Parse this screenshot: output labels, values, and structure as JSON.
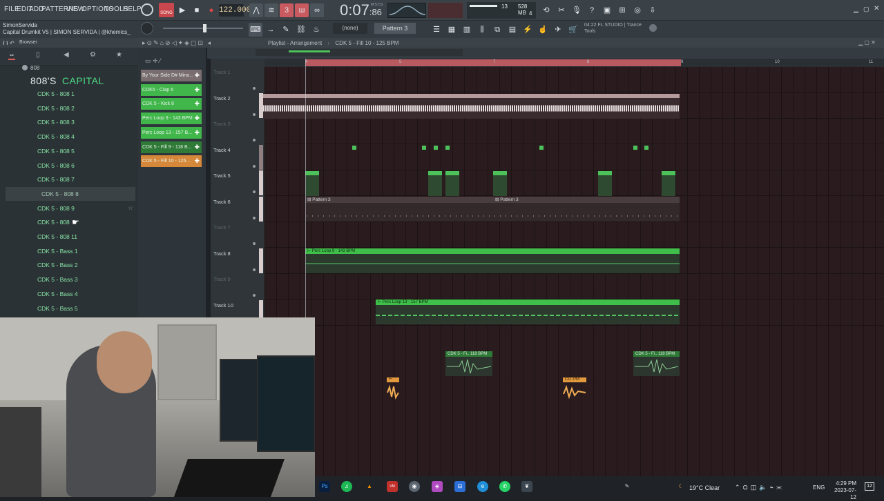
{
  "menu": {
    "items": [
      "FILE",
      "EDIT",
      "ADD",
      "PATTERNS",
      "VIEW",
      "OPTIONS",
      "TOOLS",
      "HELP"
    ]
  },
  "transport": {
    "mode_label": "SONG",
    "tempo": "122.000",
    "song_time_main": "0:07",
    "song_time_sub": "86",
    "time_label": "M:S:CS",
    "memory": "528 MB",
    "voices": "13",
    "cpu_cores": "4"
  },
  "project": {
    "author": "SimonServida",
    "title": "Capital Drumkit V5 | SIMON SERVIDA | @khemics_"
  },
  "toolbar2": {
    "none_selector": "(none)",
    "pattern_selector": "Pattern 3",
    "hint_line1": "04:22  FL STUDIO | Trance",
    "hint_line2": "Tools"
  },
  "browser": {
    "title": "Browser",
    "folder_label": "808",
    "brand_left": "808'S",
    "brand_right": "CAPITAL",
    "items": [
      "CDK 5 - 808 1",
      "CDK 5 - 808 2",
      "CDK 5 - 808 3",
      "CDK 5 - 808 4",
      "CDK 5 - 808 5",
      "CDK 5 - 808 6",
      "CDK 5 - 808 7",
      "CDK 5 - 808 8",
      "CDK 5 - 808 9",
      "CDK 5 - 808 10",
      "CDK 5 - 808 11",
      "CDK 5 - Bass 1",
      "CDK 5 - Bass 2",
      "CDK 5 - Bass 3",
      "CDK 5 - Bass 4",
      "CDK 5 - Bass 5"
    ],
    "items_display": [
      "CDK 5 - 808 1",
      "CDK 5 - 808 2",
      "CDK 5 - 808 3",
      "CDK 5 - 808 4",
      "CDK 5 - 808 5",
      "CDK 5 - 808 6",
      "CDK 5 - 808 7",
      "CDK 5 - 808 8",
      "CDK 5 - 808 9",
      "CDK 5 - 808",
      "CDK 5 - 808 11",
      "CDK 5 - Bass 1",
      "CDK 5 - Bass 2",
      "CDK 5 - Bass 3",
      "CDK 5 - Bass 4",
      "CDK 5 - Bass 5"
    ],
    "selected_index": 7
  },
  "channels": [
    {
      "label": "By Your Side D# Mino...",
      "color": "#7a6d6f"
    },
    {
      "label": "CDK5 - Clap 6",
      "color": "#41b64b"
    },
    {
      "label": "CDK 5 - Kick 8",
      "color": "#41b64b"
    },
    {
      "label": "Perc Loop 9 - 143 BPM",
      "color": "#41b64b"
    },
    {
      "label": "Perc Loop 13 - 157 B...",
      "color": "#41b64b"
    },
    {
      "label": "CDK 5 - Fill 9 - 118 B...",
      "color": "#2f7a37"
    },
    {
      "label": "CDK 5 - Fill 10 - 125...",
      "color": "#d6883a"
    }
  ],
  "playlist": {
    "title": "Playlist - Arrangement",
    "current_clip": "CDK 5 - Fill 10 - 125 BPM",
    "ruler": [
      "4",
      "5",
      "7",
      "8",
      "9",
      "10",
      "11"
    ],
    "tracks": [
      {
        "name": "Track 1",
        "dim": true
      },
      {
        "name": "Track 2",
        "dim": false
      },
      {
        "name": "Track 3",
        "dim": true
      },
      {
        "name": "Track 4",
        "dim": false
      },
      {
        "name": "Track 5",
        "dim": false
      },
      {
        "name": "Track 6",
        "dim": false
      },
      {
        "name": "Track 7",
        "dim": true
      },
      {
        "name": "Track 8",
        "dim": false
      },
      {
        "name": "Track 9",
        "dim": true
      },
      {
        "name": "Track 10",
        "dim": false
      }
    ],
    "pattern_label": "Pattern 3",
    "clip_perc9": "Perc Loop 9 - 143 BPM",
    "clip_perc13": "Perc Loop 13 - 157 BPM",
    "clip_fill": "CDK 5 - Fi.. 118 BPM",
    "clip_orange": "CD..PM"
  },
  "taskbar": {
    "weather": "19°C  Clear",
    "language": "ENG",
    "time": "4:29 PM",
    "date": "2023-07-12",
    "notifications": "12"
  },
  "colors": {
    "clip_green": "#4ec25a",
    "clip_orange": "#e39a3e",
    "loop_region": "#b85a60",
    "browser_text": "#86e2a3"
  }
}
